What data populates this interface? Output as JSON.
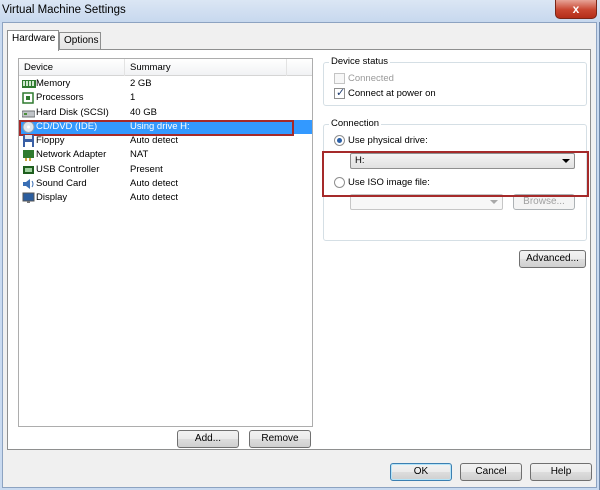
{
  "window": {
    "title": "Virtual Machine Settings",
    "close_glyph": "x"
  },
  "tabs": [
    {
      "label": "Hardware",
      "active": true
    },
    {
      "label": "Options",
      "active": false
    }
  ],
  "device_list": {
    "columns": [
      "Device",
      "Summary"
    ],
    "rows": [
      {
        "device": "Memory",
        "summary": "2 GB",
        "icon": "memory-icon"
      },
      {
        "device": "Processors",
        "summary": "1",
        "icon": "processor-icon"
      },
      {
        "device": "Hard Disk (SCSI)",
        "summary": "40 GB",
        "icon": "hard-disk-icon"
      },
      {
        "device": "CD/DVD (IDE)",
        "summary": "Using drive H:",
        "icon": "cd-dvd-icon",
        "selected": true
      },
      {
        "device": "Floppy",
        "summary": "Auto detect",
        "icon": "floppy-icon"
      },
      {
        "device": "Network Adapter",
        "summary": "NAT",
        "icon": "network-adapter-icon"
      },
      {
        "device": "USB Controller",
        "summary": "Present",
        "icon": "usb-controller-icon"
      },
      {
        "device": "Sound Card",
        "summary": "Auto detect",
        "icon": "sound-card-icon"
      },
      {
        "device": "Display",
        "summary": "Auto detect",
        "icon": "display-icon"
      }
    ]
  },
  "list_buttons": {
    "add": "Add...",
    "remove": "Remove"
  },
  "device_status": {
    "title": "Device status",
    "connected": {
      "label": "Connected",
      "checked": false,
      "enabled": false
    },
    "connect_at_power_on": {
      "label": "Connect at power on",
      "checked": true,
      "enabled": true
    }
  },
  "connection": {
    "title": "Connection",
    "use_physical_drive": {
      "label": "Use physical drive:",
      "selected": true
    },
    "physical_drive_value": "H:",
    "use_iso_image": {
      "label": "Use ISO image file:",
      "selected": false
    },
    "iso_value": "",
    "browse": "Browse..."
  },
  "advanced_button": "Advanced...",
  "footer": {
    "ok": "OK",
    "cancel": "Cancel",
    "help": "Help"
  },
  "colors": {
    "selection": "#3399ff",
    "annotation_outline": "#a52a2a",
    "title_bar": "#c7d8ee",
    "close_button": "#c8452f"
  }
}
